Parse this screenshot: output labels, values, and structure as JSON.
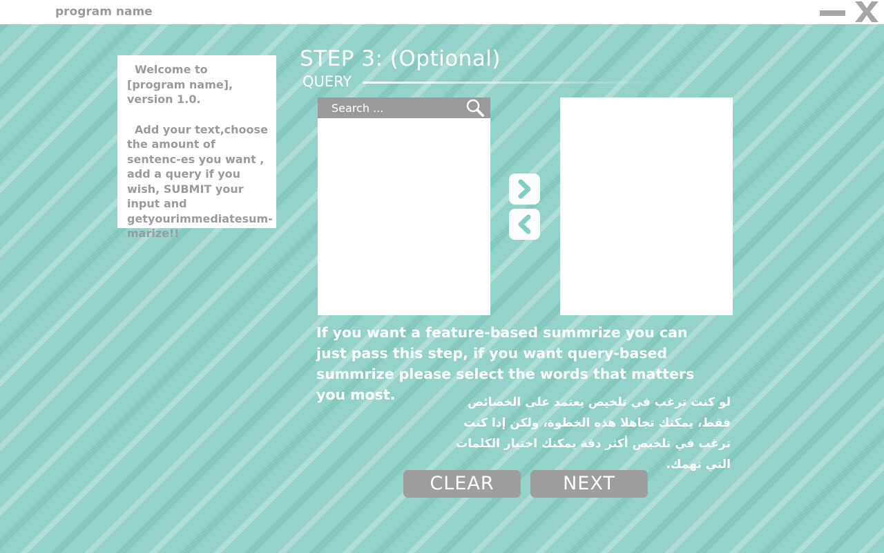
{
  "window": {
    "app_name": "program name",
    "minimize_icon": "minimize-icon",
    "close_icon": "close-icon"
  },
  "info": {
    "paragraph1": "Welcome to [program name], version 1.0.",
    "paragraph2": "Add your text,choose the amount of sentenc-es you want , add a query if you wish, SUBMIT your input and getyourimmediatesum-marize!!"
  },
  "step": {
    "title": "STEP 3: (Optional)",
    "section": "QUERY"
  },
  "search": {
    "placeholder": "Search ...",
    "value": "",
    "icon": "search-icon"
  },
  "transfer": {
    "right_icon": "chevron-right-icon",
    "left_icon": "chevron-left-icon"
  },
  "help": {
    "english": "If you want a feature-based summrize you can just pass this step, if you want query-based summrize please select the words that matters you most.",
    "arabic": "لو كنت ترغب في تلخيص يعتمد على الخصائص فقط، يمكنك تجاهلا هذه الخطوة، ولكن إذا كنت ترغب في تلخيص أكثر دقة يمكنك اختيار الكلمات التي تهمك."
  },
  "buttons": {
    "clear": "CLEAR",
    "next": "NEXT"
  },
  "colors": {
    "background": "#93d3c9",
    "accent": "#7fcfc3",
    "button_gray": "#9e9e9e",
    "text_gray": "#9a9a9a"
  }
}
